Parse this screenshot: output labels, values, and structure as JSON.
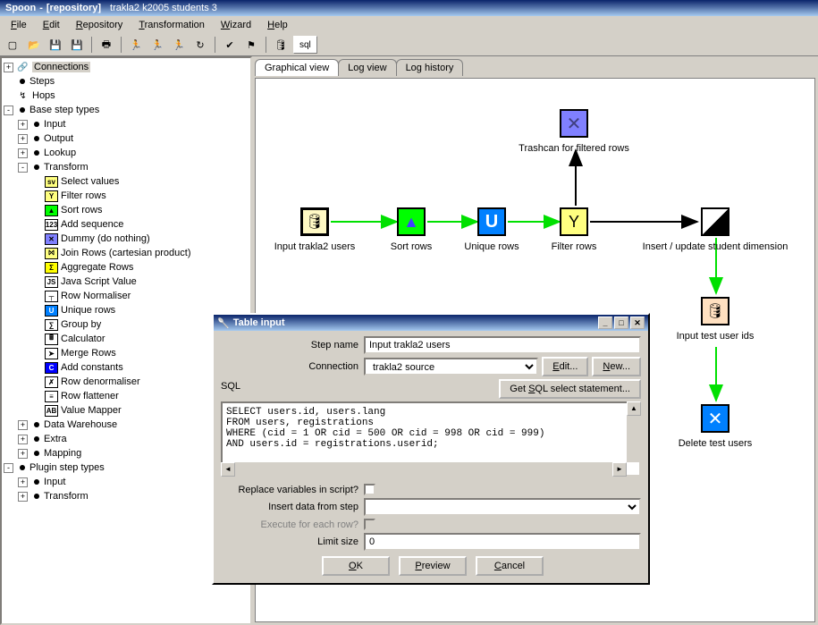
{
  "title": {
    "app": "Spoon",
    "repo": "[repository]",
    "trans": "trakla2 k2005 students 3"
  },
  "menu": [
    "File",
    "Edit",
    "Repository",
    "Transformation",
    "Wizard",
    "Help"
  ],
  "toolbar": {
    "sql_label": "sql"
  },
  "tree": {
    "top": [
      {
        "exp": "+",
        "ico": "🔗",
        "label": "Connections",
        "sel": true
      },
      {
        "exp": "",
        "ico": "•",
        "label": "Steps"
      },
      {
        "exp": "",
        "ico": "↯",
        "label": "Hops"
      },
      {
        "exp": "-",
        "ico": "•",
        "label": "Base step types"
      }
    ],
    "base": [
      {
        "exp": "+",
        "label": "Input"
      },
      {
        "exp": "+",
        "label": "Output"
      },
      {
        "exp": "+",
        "label": "Lookup"
      },
      {
        "exp": "-",
        "label": "Transform"
      }
    ],
    "transform": [
      {
        "ico": "sv",
        "label": "Select values",
        "bg": "#ffff80"
      },
      {
        "ico": "Y",
        "label": "Filter rows",
        "bg": "#ffff80"
      },
      {
        "ico": "▲",
        "label": "Sort rows",
        "bg": "#00ff00"
      },
      {
        "ico": "123",
        "label": "Add sequence",
        "bg": "#fff"
      },
      {
        "ico": "✕",
        "label": "Dummy (do nothing)",
        "bg": "#8080ff"
      },
      {
        "ico": "⨝",
        "label": "Join Rows (cartesian product)",
        "bg": "#ffff80"
      },
      {
        "ico": "Σ",
        "label": "Aggregate Rows",
        "bg": "#ffff00"
      },
      {
        "ico": "JS",
        "label": "Java Script Value",
        "bg": "#fff"
      },
      {
        "ico": "┬",
        "label": "Row Normaliser",
        "bg": "#fff"
      },
      {
        "ico": "U",
        "label": "Unique rows",
        "bg": "#0080ff"
      },
      {
        "ico": "∑",
        "label": "Group by",
        "bg": "#fff"
      },
      {
        "ico": "🖩",
        "label": "Calculator",
        "bg": "#fff"
      },
      {
        "ico": "➤",
        "label": "Merge Rows",
        "bg": "#fff"
      },
      {
        "ico": "C",
        "label": "Add constants",
        "bg": "#0000ff"
      },
      {
        "ico": "✗",
        "label": "Row denormaliser",
        "bg": "#fff"
      },
      {
        "ico": "≡",
        "label": "Row flattener",
        "bg": "#fff"
      },
      {
        "ico": "AB",
        "label": "Value Mapper",
        "bg": "#fff"
      }
    ],
    "base_tail": [
      {
        "exp": "+",
        "label": "Data Warehouse"
      },
      {
        "exp": "+",
        "label": "Extra"
      },
      {
        "exp": "+",
        "label": "Mapping"
      }
    ],
    "plugin": [
      {
        "exp": "-",
        "label": "Plugin step types"
      },
      {
        "exp": "+",
        "label": "Input",
        "indent": 1
      },
      {
        "exp": "+",
        "label": "Transform",
        "indent": 1
      }
    ]
  },
  "canvas": {
    "tabs": [
      "Graphical view",
      "Log view",
      "Log history"
    ],
    "nodes": {
      "trash": {
        "label": "Trashcan for filtered rows"
      },
      "input": {
        "label": "Input trakla2 users"
      },
      "sort": {
        "label": "Sort rows"
      },
      "unique": {
        "label": "Unique rows"
      },
      "filter": {
        "label": "Filter rows"
      },
      "insert": {
        "label": "Insert / update student dimension"
      },
      "testids": {
        "label": "Input test user ids"
      },
      "delete": {
        "label": "Delete test users"
      }
    }
  },
  "dialog": {
    "title": "Table input",
    "step_name_lbl": "Step name",
    "step_name_val": "Input trakla2 users",
    "conn_lbl": "Connection",
    "conn_val": "trakla2 source",
    "edit_btn": "Edit...",
    "new_btn": "New...",
    "sql_lbl": "SQL",
    "get_sql_btn": "Get SQL select statement...",
    "sql_text": "SELECT users.id, users.lang\nFROM users, registrations\nWHERE (cid = 1 OR cid = 500 OR cid = 998 OR cid = 999)\nAND users.id = registrations.userid;",
    "replace_lbl": "Replace variables in script?",
    "insert_lbl": "Insert data from step",
    "each_lbl": "Execute for each row?",
    "limit_lbl": "Limit size",
    "limit_val": "0",
    "ok": "OK",
    "preview": "Preview",
    "cancel": "Cancel"
  }
}
